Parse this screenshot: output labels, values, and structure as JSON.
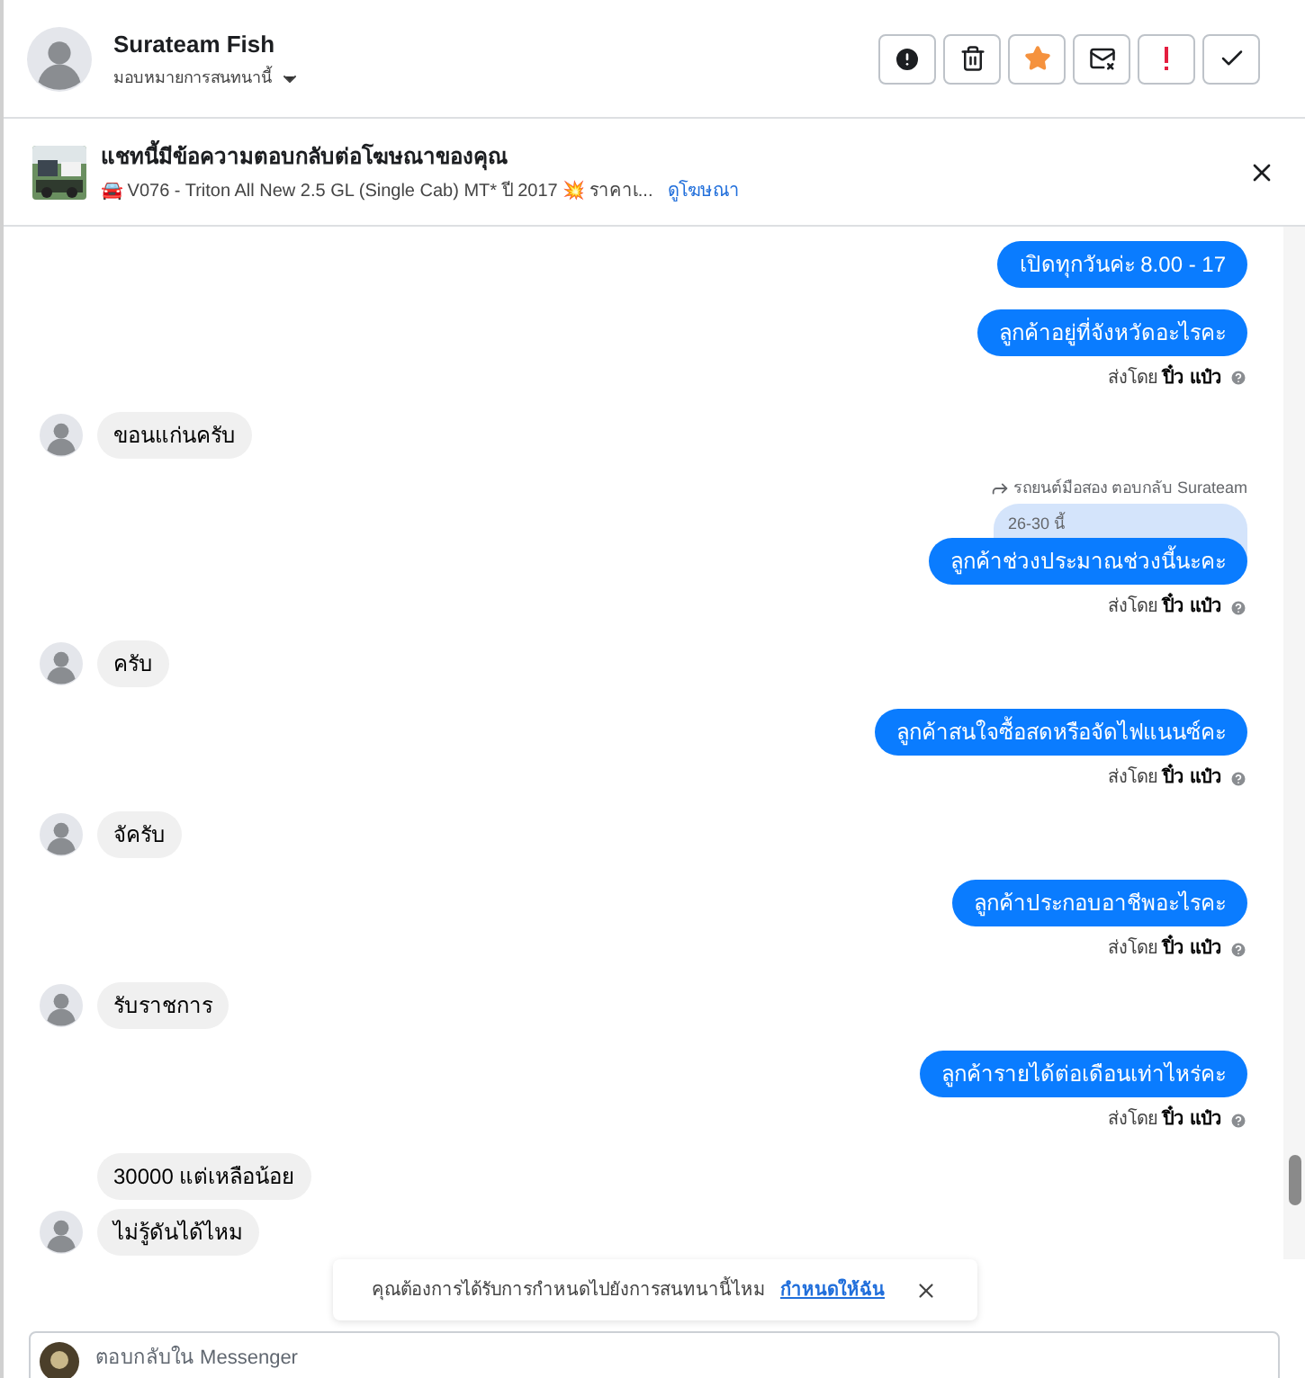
{
  "header": {
    "name": "Surateam Fish",
    "assign_label": "มอบหมายการสนทนานี้",
    "actions": [
      {
        "kind": "report"
      },
      {
        "kind": "delete"
      },
      {
        "kind": "star"
      },
      {
        "kind": "unread"
      },
      {
        "kind": "spam"
      },
      {
        "kind": "done"
      }
    ]
  },
  "ad_banner": {
    "title": "แชทนี้มีข้อความตอบกลับต่อโฆษณาของคุณ",
    "snippet": "🚘 V076 - Triton All New 2.5 GL (Single Cab) MT* ปี 2017 💥 ราคาเ...",
    "link": "ดูโฆษณา"
  },
  "messages": [
    {
      "kind": "out",
      "text": "เปิดทุกวันค่ะ 8.00 - 17"
    },
    {
      "kind": "out",
      "text": "ลูกค้าอยู่ที่จังหวัดอะไรคะ"
    },
    {
      "kind": "sent_by",
      "prefix": "ส่งโดย",
      "name": "ปิ๋ว แป๋ว"
    },
    {
      "kind": "in",
      "text": "ขอนแก่นครับ",
      "avatar": true
    },
    {
      "kind": "reply",
      "label": "รถยนต์มือสอง ตอบกลับ Surateam",
      "quoted": "26-30 นี้"
    },
    {
      "kind": "out",
      "text": "ลูกค้าช่วงประมาณช่วงนี้นะคะ"
    },
    {
      "kind": "sent_by",
      "prefix": "ส่งโดย",
      "name": "ปิ๋ว แป๋ว"
    },
    {
      "kind": "in",
      "text": "ครับ",
      "avatar": true
    },
    {
      "kind": "out",
      "text": "ลูกค้าสนใจซื้อสดหรือจัดไฟแนนซ์คะ"
    },
    {
      "kind": "sent_by",
      "prefix": "ส่งโดย",
      "name": "ปิ๋ว แป๋ว"
    },
    {
      "kind": "in",
      "text": "จัครับ",
      "avatar": true
    },
    {
      "kind": "out",
      "text": "ลูกค้าประกอบอาชีพอะไรคะ"
    },
    {
      "kind": "sent_by",
      "prefix": "ส่งโดย",
      "name": "ปิ๋ว แป๋ว"
    },
    {
      "kind": "in",
      "text": "รับราชการ",
      "avatar": true
    },
    {
      "kind": "out",
      "text": "ลูกค้ารายได้ต่อเดือนเท่าไหร่คะ"
    },
    {
      "kind": "sent_by",
      "prefix": "ส่งโดย",
      "name": "ปิ๋ว แป๋ว"
    },
    {
      "kind": "in",
      "text": "30000 แต่เหลือน้อย",
      "avatar": false
    },
    {
      "kind": "in",
      "text": "ไม่รู้ดันได้ไหม",
      "avatar": true
    }
  ],
  "assign_prompt": {
    "text": "คุณต้องการได้รับการกำหนดไปยังการสนทนานี้ไหม",
    "link": "กำหนดให้ฉัน"
  },
  "composer": {
    "placeholder": "ตอบกลับใน Messenger"
  }
}
